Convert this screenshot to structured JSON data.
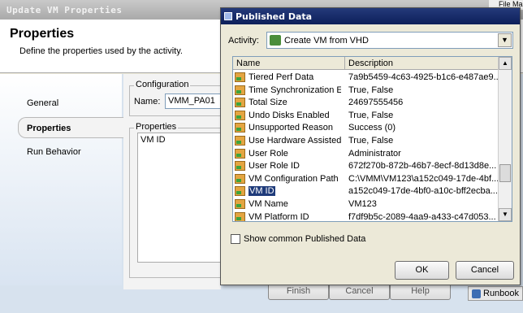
{
  "background": {
    "window_title": "Update VM Properties",
    "heading": "Properties",
    "description": "Define the properties used by the activity.",
    "nav": [
      "General",
      "Properties",
      "Run Behavior"
    ],
    "configuration_label": "Configuration",
    "name_label": "Name:",
    "name_value": "VMM_PA01",
    "properties_label": "Properties",
    "properties_items": [
      "VM ID"
    ],
    "buttons": {
      "finish": "Finish",
      "cancel": "Cancel",
      "help": "Help"
    },
    "taskbar_file": "File Mana",
    "taskbar_runbook": "Runbook"
  },
  "dialog": {
    "title": "Published Data",
    "activity_label": "Activity:",
    "activity_value": "Create VM from VHD",
    "columns": {
      "name": "Name",
      "description": "Description"
    },
    "rows": [
      {
        "name": "Tiered Perf Data",
        "description": "7a9b5459-4c63-4925-b1c6-e487ae9..."
      },
      {
        "name": "Time Synchronization E...",
        "description": "True, False"
      },
      {
        "name": "Total Size",
        "description": "24697555456"
      },
      {
        "name": "Undo Disks Enabled",
        "description": "True, False"
      },
      {
        "name": "Unsupported Reason",
        "description": "Success (0)"
      },
      {
        "name": "Use Hardware Assisted ...",
        "description": "True, False"
      },
      {
        "name": "User Role",
        "description": "Administrator"
      },
      {
        "name": "User Role ID",
        "description": "672f270b-872b-46b7-8ecf-8d13d8e..."
      },
      {
        "name": "VM Configuration Path",
        "description": "C:\\VMM\\VM123\\a152c049-17de-4bf..."
      },
      {
        "name": "VM ID",
        "description": "a152c049-17de-4bf0-a10c-bff2ecba...",
        "selected": true
      },
      {
        "name": "VM Name",
        "description": "VM123"
      },
      {
        "name": "VM Platform ID",
        "description": "f7df9b5c-2089-4aa9-a433-c47d053..."
      }
    ],
    "show_common_label": "Show common Published Data",
    "show_common_checked": false,
    "ok_label": "OK",
    "cancel_label": "Cancel"
  },
  "colors": {
    "title_bar": "#1a2f6e",
    "selection": "#1f3b7a"
  }
}
